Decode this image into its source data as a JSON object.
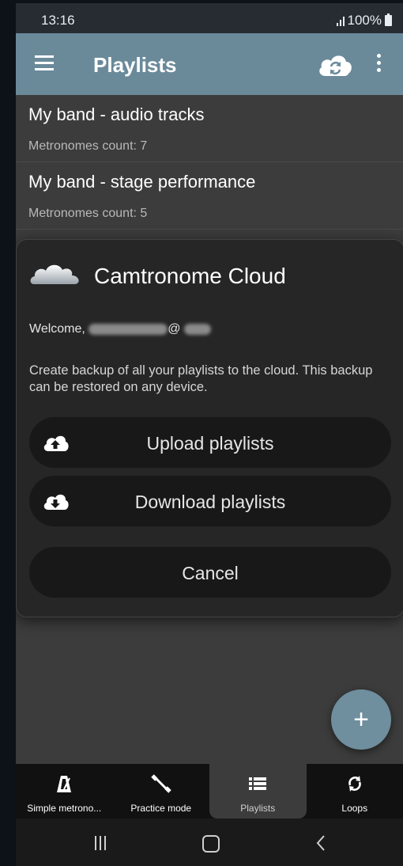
{
  "status_bar": {
    "time": "13:16",
    "battery": "100%"
  },
  "toolbar": {
    "title": "Playlists"
  },
  "playlists": [
    {
      "name": "My band - audio tracks",
      "count": "Metronomes count: 7"
    },
    {
      "name": "My band - stage performance",
      "count": "Metronomes count: 5"
    }
  ],
  "dialog": {
    "title": "Camtronome Cloud",
    "welcome_prefix": "Welcome,",
    "email_at": "@",
    "description": "Create backup of all your playlists to the cloud. This backup can be restored on any device.",
    "upload_label": "Upload playlists",
    "download_label": "Download playlists",
    "cancel_label": "Cancel"
  },
  "fab": {
    "label": "+"
  },
  "bottom_nav": [
    {
      "label": "Simple metrono...",
      "icon": "metronome-icon",
      "active": false
    },
    {
      "label": "Practice mode",
      "icon": "practice-mode-icon",
      "active": false
    },
    {
      "label": "Playlists",
      "icon": "list-icon",
      "active": true
    },
    {
      "label": "Loops",
      "icon": "loop-icon",
      "active": false
    }
  ],
  "colors": {
    "toolbar": "#6a8a9a",
    "fab": "#6f8e9e",
    "dialog": "#262626",
    "background": "#3c3c3c"
  }
}
